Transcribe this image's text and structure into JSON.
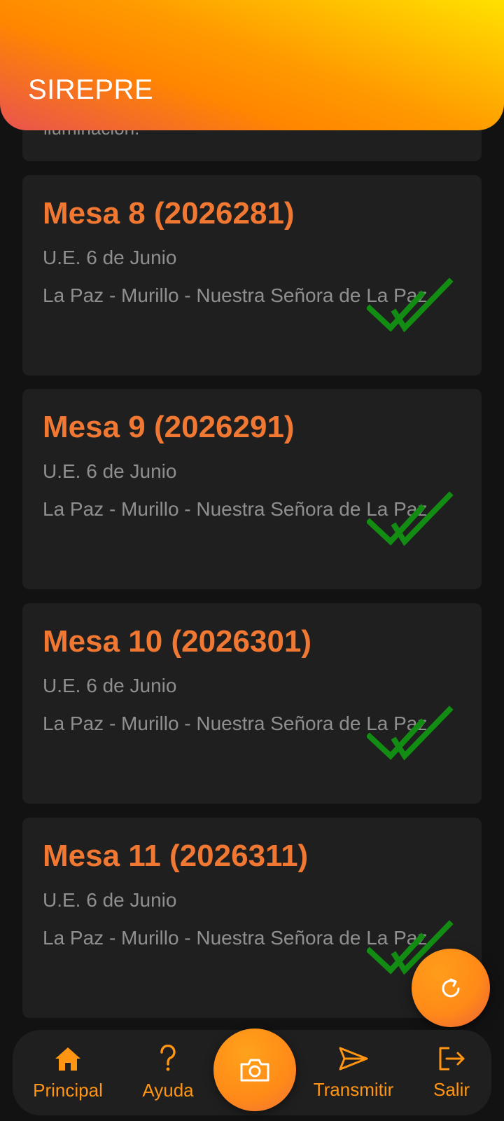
{
  "app_bar": {
    "title": "SIREPRE"
  },
  "partial_card": {
    "text": "iluminación."
  },
  "mesas": [
    {
      "title": "Mesa 8 (2026281)",
      "school": "U.E. 6 de Junio",
      "location": "La Paz - Murillo - Nuestra Señora de La Paz",
      "status_icon": "double-check-icon"
    },
    {
      "title": "Mesa 9 (2026291)",
      "school": "U.E. 6 de Junio",
      "location": "La Paz - Murillo - Nuestra Señora de La Paz",
      "status_icon": "double-check-icon"
    },
    {
      "title": "Mesa 10 (2026301)",
      "school": "U.E. 6 de Junio",
      "location": "La Paz - Murillo - Nuestra Señora de La Paz",
      "status_icon": "double-check-icon"
    },
    {
      "title": "Mesa 11 (2026311)",
      "school": "U.E. 6 de Junio",
      "location": "La Paz - Murillo - Nuestra Señora de La Paz",
      "status_icon": "double-check-icon"
    }
  ],
  "fab": {
    "icon": "refresh-icon"
  },
  "bottom_nav": {
    "items": [
      {
        "label": "Principal",
        "icon": "home-icon"
      },
      {
        "label": "Ayuda",
        "icon": "help-icon"
      },
      {
        "label": "",
        "icon": "camera-icon"
      },
      {
        "label": "Transmitir",
        "icon": "send-icon"
      },
      {
        "label": "Salir",
        "icon": "logout-icon"
      }
    ]
  },
  "colors": {
    "accent": "#ff9512",
    "card_title": "#f07832",
    "check": "#138c13",
    "background": "#121212",
    "card": "#1f1f1f"
  }
}
